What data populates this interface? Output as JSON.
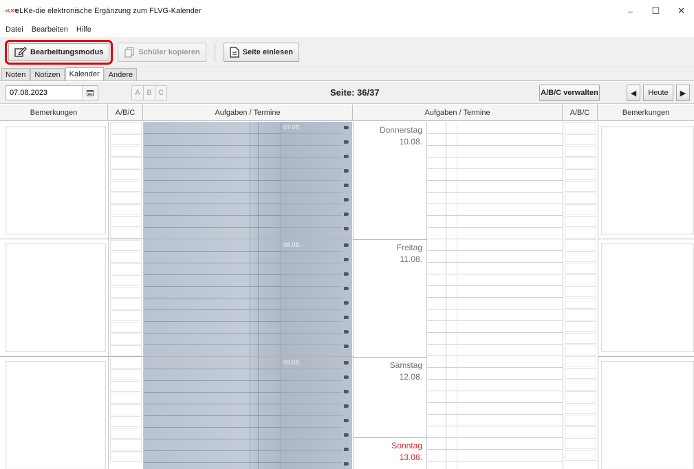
{
  "window": {
    "title": "eLKe-die elektronische Ergänzung zum FLVG-Kalender",
    "logo_text": "eLKE",
    "controls": [
      "–",
      "☐",
      "✕"
    ]
  },
  "menu": [
    "Datei",
    "Bearbeiten",
    "Hilfe"
  ],
  "toolbar": {
    "edit_mode_label": "Bearbeitungsmodus",
    "copy_students_label": "Schüler kopieren",
    "import_page_label": "Seite einlesen"
  },
  "tabs": [
    {
      "label": "Noten",
      "active": false
    },
    {
      "label": "Notizen",
      "active": false
    },
    {
      "label": "Kalender",
      "active": true
    },
    {
      "label": "Andere",
      "active": false
    }
  ],
  "controls": {
    "date_value": "07.08.2023",
    "abc_buttons": [
      "A",
      "B",
      "C"
    ],
    "page_label": "Seite: 36/37",
    "manage_abc_label": "A/B/C verwalten",
    "prev_symbol": "◀",
    "today_label": "Heute",
    "next_symbol": "▶"
  },
  "columns": {
    "remarks_left": "Bemerkungen",
    "abc_left": "A/B/C",
    "tasks_left": "Aufgaben / Termine",
    "tasks_right": "Aufgaben / Termine",
    "abc_right": "A/B/C",
    "remarks_right": "Bemerkungen"
  },
  "scan_dates": [
    "07.08.",
    "08.08.",
    "09.08."
  ],
  "days": [
    {
      "weekday": "Donnerstag",
      "date": "10.08.",
      "sunday": false
    },
    {
      "weekday": "Freitag",
      "date": "11.08.",
      "sunday": false
    },
    {
      "weekday": "Samstag",
      "date": "12.08.",
      "sunday": false
    },
    {
      "weekday": "Sonntag",
      "date": "13.08.",
      "sunday": true
    }
  ],
  "colors": {
    "highlight": "#e00000",
    "sunday": "#d9252c",
    "weekday": "#6f6f6f"
  }
}
